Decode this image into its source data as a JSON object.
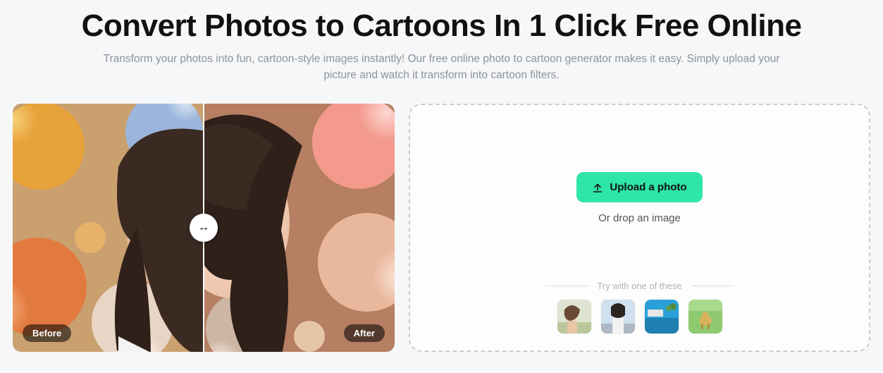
{
  "header": {
    "title": "Convert Photos to Cartoons In 1 Click Free Online",
    "subtitle": "Transform your photos into fun, cartoon-style images instantly! Our free online photo to cartoon generator makes it easy. Simply upload your picture and watch it transform into cartoon filters."
  },
  "compare": {
    "before_label": "Before",
    "after_label": "After"
  },
  "upload": {
    "button": "Upload a photo",
    "drop_text": "Or drop an image",
    "try_label": "Try with one of these"
  }
}
